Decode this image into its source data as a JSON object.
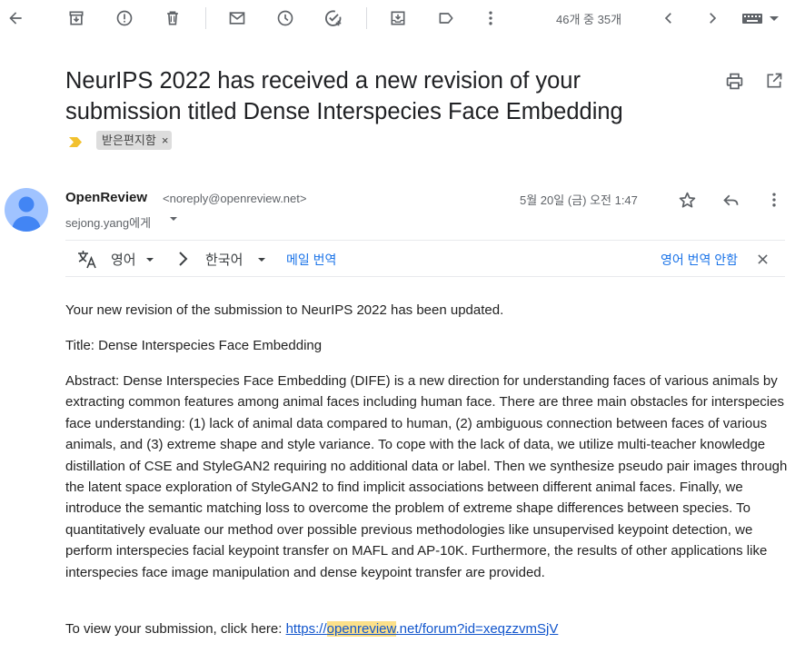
{
  "toolbar": {
    "page_count": "46개 중 35개"
  },
  "email": {
    "subject": "NeurIPS 2022 has received a new revision of your submission titled Dense Interspecies Face Embedding",
    "label": "받은편지함",
    "label_remove": "×",
    "sender_name": "OpenReview",
    "sender_email": "<noreply@openreview.net>",
    "recipient": "sejong.yang에게",
    "datetime": "5월 20일 (금) 오전 1:47"
  },
  "translation": {
    "source_language": "영어",
    "target_language": "한국어",
    "translate_label": "메일 번역",
    "never_translate_label": "영어 번역 안함"
  },
  "body": {
    "paragraph1": "Your new revision of the submission to NeurIPS 2022 has been updated.",
    "paragraph2": "Title: Dense Interspecies Face Embedding",
    "paragraph3": "Abstract: Dense Interspecies Face Embedding (DIFE) is a new direction for understanding faces of various animals by extracting common features among animal faces including human face. There are three main obstacles for interspecies face understanding: (1) lack of animal data compared to human, (2) ambiguous connection between faces of various animals, and (3) extreme shape and style variance. To cope with the lack of data, we utilize multi-teacher knowledge distillation of CSE and StyleGAN2 requiring no additional data or label. Then we synthesize pseudo pair images through the latent space exploration of StyleGAN2 to find implicit associations between different animal faces. Finally, we introduce the semantic matching loss to overcome the problem of extreme shape differences between species. To quantitatively evaluate our method over possible previous methodologies like unsupervised keypoint detection, we perform interspecies facial keypoint transfer on MAFL and AP-10K. Furthermore, the results of other applications like interspecies face image manipulation and dense keypoint transfer are provided.",
    "link_prefix": "To view your submission, click here: ",
    "link_part1": "https://",
    "link_highlight": "openreview",
    "link_part2": ".net/forum?id=xeqzzvmSjV"
  },
  "colors": {
    "link": "#1155cc",
    "translate_link": "#1a73e8",
    "highlight": "#fce08a",
    "importance_marker": "#f2c12e",
    "avatar_bg": "#a0c3ff",
    "avatar_fg": "#4285f4"
  },
  "icons": [
    "back-arrow-icon",
    "archive-icon",
    "report-spam-icon",
    "delete-icon",
    "mark-unread-icon",
    "snooze-icon",
    "add-task-icon",
    "move-to-icon",
    "label-icon",
    "more-vert-icon",
    "newer-chevron-icon",
    "older-chevron-icon",
    "keyboard-icon",
    "print-icon",
    "open-new-window-icon",
    "star-icon",
    "reply-icon",
    "translate-icon",
    "chevron-right-icon",
    "close-icon"
  ]
}
